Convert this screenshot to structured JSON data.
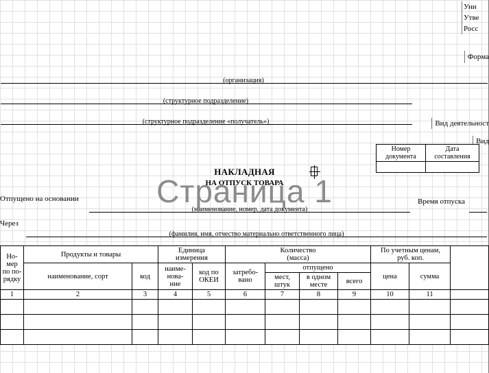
{
  "top_right": {
    "l1": "Уни",
    "l2": "Утве",
    "l3": "Росс"
  },
  "forma_label": "Форма",
  "org_label": "(организация)",
  "struct_label": "(структурное подразделение)",
  "struct_recv_label": "(структурное подразделение «получатель»)",
  "vid_label": "Вид деятельност",
  "vid_short": "Вид",
  "docbox": {
    "num_hdr": "Номер\nдокумента",
    "date_hdr": "Дата\nсоставления",
    "num_val": "",
    "date_val": ""
  },
  "title1": "НАКЛАДНАЯ",
  "title2": "НА ОТПУСК ТОВАРА",
  "watermark": "Страница 1",
  "otpushcheno": "Отпущено на основании",
  "naimdoc_label": "(наименование, номер, дата документа)",
  "cherez": "Через",
  "fio_label": "(фамилия, имя, отчество материально ответственного лица)",
  "vremya": "Время отпуска",
  "table": {
    "h_num": "Но-\nмер\nпо по-\nрядку",
    "h_prod": "Продукты и товары",
    "h_unit": "Единица\nизмерения",
    "h_qty": "Количество\n(масса)",
    "h_price": "По учетным ценам,\nруб. коп.",
    "h_name_sort": "наименование, сорт",
    "h_code": "код",
    "h_unit_name": "наиме-\nнова-\nние",
    "h_okei": "код по\nОКЕИ",
    "h_req": "затребо-\nвано",
    "h_rel": "отпущено",
    "h_places": "мест,\nштук",
    "h_inone": "в одном\nместе",
    "h_total": "всего",
    "h_cena": "цена",
    "h_summa": "сумма",
    "cols": [
      "1",
      "2",
      "3",
      "4",
      "5",
      "6",
      "7",
      "8",
      "9",
      "10",
      "11"
    ]
  }
}
